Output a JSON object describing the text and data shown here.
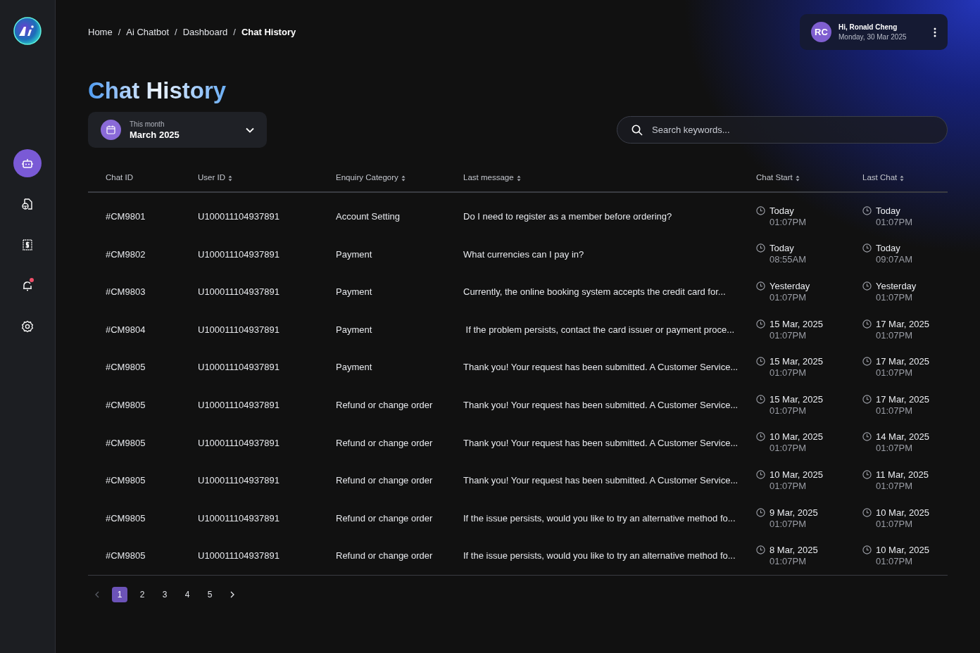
{
  "sidebar": {
    "items": [
      {
        "kind": "bot",
        "selected": true,
        "unread": false
      },
      {
        "kind": "document",
        "selected": false,
        "unread": false
      },
      {
        "kind": "billing",
        "selected": false,
        "unread": false
      },
      {
        "kind": "bell",
        "selected": false,
        "unread": true
      },
      {
        "kind": "settings",
        "selected": false,
        "unread": false
      }
    ]
  },
  "breadcrumb": [
    {
      "label": "Home",
      "current": false
    },
    {
      "label": "Ai Chatbot",
      "current": false
    },
    {
      "label": "Dashboard",
      "current": false
    },
    {
      "label": "Chat History",
      "current": true
    }
  ],
  "breadcrumb_separator": "/",
  "user": {
    "initials": "RC",
    "greeting": "Hi, Ronald Cheng",
    "date": "Monday, 30 Mar 2025"
  },
  "page_title": "Chat History",
  "period_selector": {
    "label": "This month",
    "value": "March 2025"
  },
  "search": {
    "placeholder": "Search keywords..."
  },
  "table": {
    "columns": [
      {
        "label": "Chat ID",
        "sortable": false
      },
      {
        "label": "User ID",
        "sortable": true
      },
      {
        "label": "Enquiry Category",
        "sortable": true
      },
      {
        "label": "Last message",
        "sortable": true
      },
      {
        "label": "Chat Start",
        "sortable": true
      },
      {
        "label": "Last Chat",
        "sortable": true
      }
    ],
    "rows": [
      {
        "chat_id": "#CM9801",
        "user_id": "U100011104937891",
        "category": "Account Setting",
        "last_message": "Do I need to register as a member before ordering?",
        "chat_start": {
          "date": "Today",
          "time": "01:07PM"
        },
        "last_chat": {
          "date": "Today",
          "time": "01:07PM"
        }
      },
      {
        "chat_id": "#CM9802",
        "user_id": "U100011104937891",
        "category": "Payment",
        "last_message": "What currencies can I pay in?",
        "chat_start": {
          "date": "Today",
          "time": "08:55AM"
        },
        "last_chat": {
          "date": "Today",
          "time": "09:07AM"
        }
      },
      {
        "chat_id": "#CM9803",
        "user_id": "U100011104937891",
        "category": "Payment",
        "last_message": "Currently, the online booking system accepts the credit card for...",
        "chat_start": {
          "date": "Yesterday",
          "time": "01:07PM"
        },
        "last_chat": {
          "date": "Yesterday",
          "time": "01:07PM"
        }
      },
      {
        "chat_id": "#CM9804",
        "user_id": "U100011104937891",
        "category": "Payment",
        "last_message": " If the problem persists, contact the card issuer or payment proce...",
        "chat_start": {
          "date": "15 Mar, 2025",
          "time": "01:07PM"
        },
        "last_chat": {
          "date": "17 Mar, 2025",
          "time": "01:07PM"
        }
      },
      {
        "chat_id": "#CM9805",
        "user_id": "U100011104937891",
        "category": "Payment",
        "last_message": "Thank you! Your request has been submitted. A Customer Service...",
        "chat_start": {
          "date": "15 Mar, 2025",
          "time": "01:07PM"
        },
        "last_chat": {
          "date": "17 Mar, 2025",
          "time": "01:07PM"
        }
      },
      {
        "chat_id": "#CM9805",
        "user_id": "U100011104937891",
        "category": "Refund or change order",
        "last_message": "Thank you! Your request has been submitted. A Customer Service...",
        "chat_start": {
          "date": "15 Mar, 2025",
          "time": "01:07PM"
        },
        "last_chat": {
          "date": "17 Mar, 2025",
          "time": "01:07PM"
        }
      },
      {
        "chat_id": "#CM9805",
        "user_id": "U100011104937891",
        "category": "Refund or change order",
        "last_message": "Thank you! Your request has been submitted. A Customer Service...",
        "chat_start": {
          "date": "10 Mar, 2025",
          "time": "01:07PM"
        },
        "last_chat": {
          "date": "14 Mar, 2025",
          "time": "01:07PM"
        }
      },
      {
        "chat_id": "#CM9805",
        "user_id": "U100011104937891",
        "category": "Refund or change order",
        "last_message": "Thank you! Your request has been submitted. A Customer Service...",
        "chat_start": {
          "date": "10 Mar, 2025",
          "time": "01:07PM"
        },
        "last_chat": {
          "date": "11 Mar, 2025",
          "time": "01:07PM"
        }
      },
      {
        "chat_id": "#CM9805",
        "user_id": "U100011104937891",
        "category": "Refund or change order",
        "last_message": "If the issue persists, would you like to try an alternative method fo...",
        "chat_start": {
          "date": "9 Mar, 2025",
          "time": "01:07PM"
        },
        "last_chat": {
          "date": "10 Mar, 2025",
          "time": "01:07PM"
        }
      },
      {
        "chat_id": "#CM9805",
        "user_id": "U100011104937891",
        "category": "Refund or change order",
        "last_message": "If the issue persists, would you like to try an alternative method fo...",
        "chat_start": {
          "date": "8 Mar, 2025",
          "time": "01:07PM"
        },
        "last_chat": {
          "date": "10 Mar, 2025",
          "time": "01:07PM"
        }
      }
    ]
  },
  "pagination": {
    "prev": {
      "disabled": true
    },
    "next": {
      "disabled": false
    },
    "pages": [
      {
        "label": "1",
        "selected": true
      },
      {
        "label": "2",
        "selected": false
      },
      {
        "label": "3",
        "selected": false
      },
      {
        "label": "4",
        "selected": false
      },
      {
        "label": "5",
        "selected": false
      }
    ]
  }
}
